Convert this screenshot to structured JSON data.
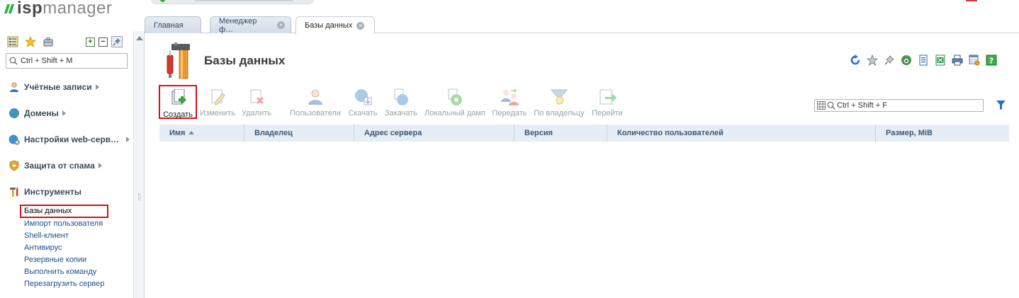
{
  "logo": {
    "part1": "isp",
    "part2": "manager"
  },
  "sidebar": {
    "search_placeholder": "Ctrl + Shift + M",
    "sections": [
      {
        "label": "Учётные записи"
      },
      {
        "label": "Домены"
      },
      {
        "label": "Настройки web-серв…"
      },
      {
        "label": "Защита от спама"
      },
      {
        "label": "Инструменты"
      }
    ],
    "tools_items": [
      {
        "label": "Базы данных",
        "active": true
      },
      {
        "label": "Импорт пользователя"
      },
      {
        "label": "Shell-клиент"
      },
      {
        "label": "Антивирус"
      },
      {
        "label": "Резервные копии"
      },
      {
        "label": "Выполнить команду"
      },
      {
        "label": "Перезагрузить сервер"
      }
    ]
  },
  "tabs": [
    {
      "label": "Главная",
      "closable": false
    },
    {
      "label": "Менеджер ф…",
      "closable": true
    },
    {
      "label": "Базы данных",
      "closable": true,
      "active": true
    }
  ],
  "page": {
    "title": "Базы данных"
  },
  "toolbar": {
    "buttons": [
      {
        "label": "Создать",
        "enabled": true,
        "icon": "create-icon"
      },
      {
        "label": "Изменить",
        "enabled": false,
        "icon": "edit-icon"
      },
      {
        "label": "Удалить",
        "enabled": false,
        "icon": "delete-icon"
      },
      {
        "label": "Пользователи",
        "enabled": false,
        "icon": "users-icon"
      },
      {
        "label": "Скачать",
        "enabled": false,
        "icon": "download-icon"
      },
      {
        "label": "Закачать",
        "enabled": false,
        "icon": "upload-icon"
      },
      {
        "label": "Локальный дамп",
        "enabled": false,
        "icon": "local-dump-icon"
      },
      {
        "label": "Передать",
        "enabled": false,
        "icon": "transfer-icon"
      },
      {
        "label": "По владельцу",
        "enabled": false,
        "icon": "owner-filter-icon"
      },
      {
        "label": "Перейти",
        "enabled": false,
        "icon": "goto-icon"
      }
    ],
    "search_placeholder": "Ctrl + Shift + F"
  },
  "table": {
    "columns": [
      {
        "label": "Имя",
        "sorted": "asc"
      },
      {
        "label": "Владелец"
      },
      {
        "label": "Адрес сервера"
      },
      {
        "label": "Версия"
      },
      {
        "label": "Количество пользователей"
      },
      {
        "label": "Размер, MiB"
      }
    ],
    "rows": []
  },
  "colors": {
    "accent_green": "#2db24a",
    "highlight_red": "#d0141a",
    "link_blue": "#1d4f8f",
    "header_bg": "#e6edf5"
  }
}
